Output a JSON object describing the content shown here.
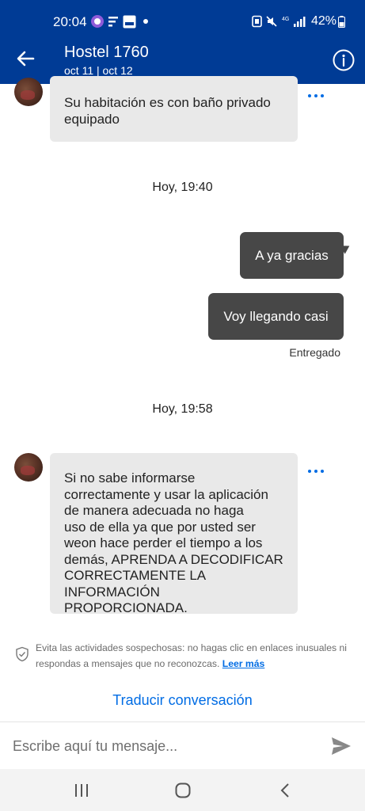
{
  "status_bar": {
    "time": "20:04",
    "battery": "42%"
  },
  "header": {
    "title": "Hostel 1760",
    "dates": "oct 11 | oct 12"
  },
  "messages": {
    "first_in": {
      "lines": [
        "Su habitación es con baño privado",
        "equipado"
      ]
    },
    "timestamp_1": "Hoy, 19:40",
    "out_1": "A ya gracias",
    "out_2": "Voy llegando casi",
    "delivered": "Entregado",
    "timestamp_2": "Hoy, 19:58",
    "second_in": {
      "lines": [
        "Si no sabe informarse",
        "correctamente y usar la aplicación",
        "de manera adecuada no haga",
        "uso de ella ya que por usted ser",
        "weon hace perder el tiempo a los",
        "demás, APRENDA A DECODIFICAR",
        "CORRECTAMENTE LA",
        "INFORMACIÓN PROPORCIONADA."
      ]
    }
  },
  "warning": {
    "line1": "Evita las actividades sospechosas: no hagas clic en enlaces inusuales ni",
    "line2": "respondas a mensajes que no reconozcas.",
    "link": "Leer más"
  },
  "translate_label": "Traducir conversación",
  "composer": {
    "placeholder": "Escribe aquí tu mensaje..."
  },
  "colors": {
    "header_bg": "#003B95",
    "accent": "#006CE4",
    "outgoing_bubble": "#474747",
    "incoming_bubble": "#e9e9e9"
  }
}
